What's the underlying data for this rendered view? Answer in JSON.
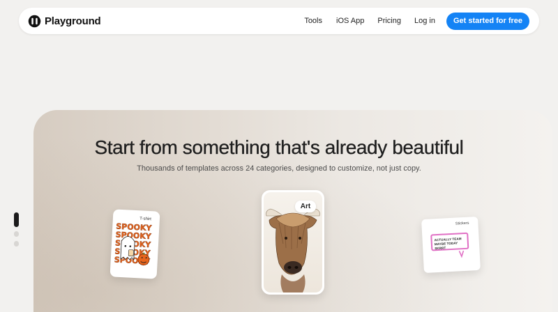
{
  "nav": {
    "brand": "Playground",
    "links": [
      "Tools",
      "iOS App",
      "Pricing",
      "Log in"
    ],
    "cta": "Get started for free"
  },
  "hero": {
    "title": "Start from something that's already beautiful",
    "subtitle": "Thousands of templates across 24 categories, designed to customize, not just copy."
  },
  "cards": {
    "tshirt": {
      "label": "T-shirt",
      "art_text": "SPOOKY"
    },
    "art": {
      "label": "Art"
    },
    "stickers": {
      "label": "Stickers",
      "bubble_text": "ACTUALLY TEAM MAYBE TODAY SKRRT"
    }
  },
  "colors": {
    "accent": "#1483f5",
    "sticker_border": "#e06fc4",
    "spooky_orange": "#e8651d"
  }
}
